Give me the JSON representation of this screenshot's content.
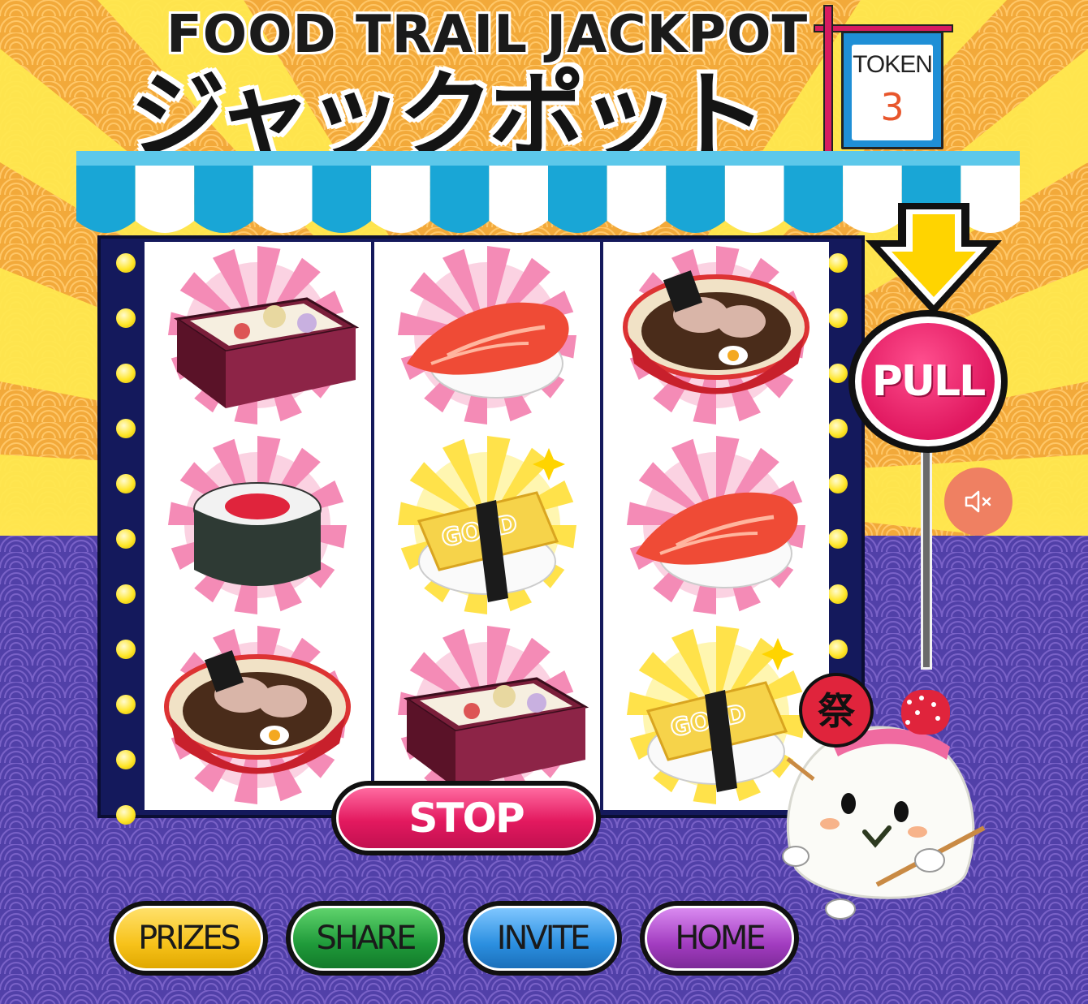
{
  "title": {
    "english": "FOOD TRAIL JACKPOT",
    "japanese": "ジャックポット"
  },
  "token": {
    "label": "TOKEN",
    "value": "3"
  },
  "reels": [
    [
      "bento-box",
      "sushi-roll",
      "ramen-bowl"
    ],
    [
      "salmon-nigiri",
      "gold-tamago-nigiri",
      "bento-box"
    ],
    [
      "ramen-bowl",
      "salmon-nigiri",
      "gold-tamago-nigiri"
    ]
  ],
  "gold_text": "GOLD",
  "controls": {
    "pull_label": "PULL",
    "stop_label": "STOP",
    "mute_icon": "speaker-muted-icon"
  },
  "nav": {
    "prizes": "PRIZES",
    "share": "SHARE",
    "invite": "INVITE",
    "home": "HOME"
  },
  "colors": {
    "prizes": "#f7c21a",
    "share": "#1f9a3a",
    "invite": "#2b8fe0",
    "home": "#a23cc0",
    "pull": "#e0175f",
    "stop": "#e3195f"
  },
  "mascot": {
    "fan_glyph": "祭"
  }
}
